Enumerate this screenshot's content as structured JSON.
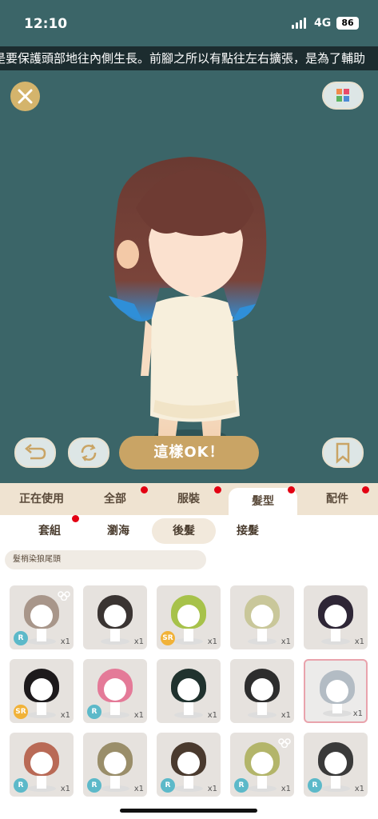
{
  "status_bar": {
    "time": "12:10",
    "network": "4G",
    "battery": "86"
  },
  "ticker_text": "是要保護頭部地往內側生長。前腳之所以有點往左右擴張，是為了輔助",
  "confirm_button": "這樣OK！",
  "category_tabs": [
    {
      "label": "正在使用"
    },
    {
      "label": "全部"
    },
    {
      "label": "服裝"
    },
    {
      "label": "髮型"
    },
    {
      "label": "配件"
    }
  ],
  "sub_tabs": [
    {
      "label": "套組"
    },
    {
      "label": "瀏海"
    },
    {
      "label": "後髮"
    },
    {
      "label": "接髮"
    }
  ],
  "search_tag": "髮梢染狼尾頭",
  "items": [
    {
      "rarity": "R",
      "qty": "x1",
      "hair": "#a8968a"
    },
    {
      "rarity": "",
      "qty": "x1",
      "hair": "#3a3432"
    },
    {
      "rarity": "SR",
      "qty": "x1",
      "hair": "#a7c24a"
    },
    {
      "rarity": "",
      "qty": "x1",
      "hair": "#c9c79a"
    },
    {
      "rarity": "",
      "qty": "x1",
      "hair": "#2e2636"
    },
    {
      "rarity": "SR",
      "qty": "x1",
      "hair": "#1d1a1c"
    },
    {
      "rarity": "R",
      "qty": "x1",
      "hair": "#e47a98"
    },
    {
      "rarity": "",
      "qty": "x1",
      "hair": "#20322e"
    },
    {
      "rarity": "",
      "qty": "x1",
      "hair": "#2d2d2d"
    },
    {
      "rarity": "",
      "qty": "x1",
      "hair": "#b3bcc4"
    },
    {
      "rarity": "R",
      "qty": "x1",
      "hair": "#b96a56"
    },
    {
      "rarity": "R",
      "qty": "x1",
      "hair": "#9a8e6a"
    },
    {
      "rarity": "R",
      "qty": "x1",
      "hair": "#4a3a2e"
    },
    {
      "rarity": "R",
      "qty": "x1",
      "hair": "#b3b56a"
    },
    {
      "rarity": "R",
      "qty": "x1",
      "hair": "#3a3a3a"
    }
  ]
}
